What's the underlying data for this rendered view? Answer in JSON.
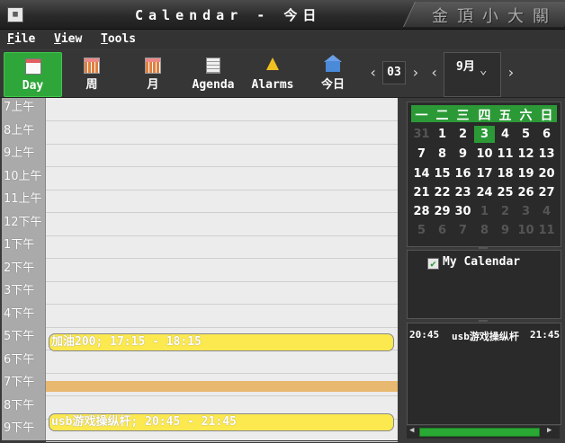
{
  "window": {
    "title": "Calendar - 今日",
    "brand": "金頂小大關"
  },
  "menu": [
    {
      "label": "File",
      "key": "F",
      "rest": "ile"
    },
    {
      "label": "View",
      "key": "V",
      "rest": "iew"
    },
    {
      "label": "Tools",
      "key": "T",
      "rest": "ools"
    }
  ],
  "toolbar": {
    "day": "Day",
    "week": "周",
    "month": "月",
    "agenda": "Agenda",
    "alarms": "Alarms",
    "today": "今日",
    "day_value": "03",
    "month_value": "9月"
  },
  "hours": [
    "7上午",
    "8上午",
    "9上午",
    "10上午",
    "11上午",
    "12下午",
    "1下午",
    "2下午",
    "3下午",
    "4下午",
    "5下午",
    "6下午",
    "7下午",
    "8下午",
    "9下午"
  ],
  "events": [
    {
      "text": "加油200; 17:15 - 18:15"
    },
    {
      "text": "usb游戏操纵杆; 20:45 - 21:45"
    }
  ],
  "mini_calendar": {
    "weekdays": [
      "一",
      "二",
      "三",
      "四",
      "五",
      "六",
      "日"
    ],
    "weeks": [
      [
        "31",
        "1",
        "2",
        "3",
        "4",
        "5",
        "6"
      ],
      [
        "7",
        "8",
        "9",
        "10",
        "11",
        "12",
        "13"
      ],
      [
        "14",
        "15",
        "16",
        "17",
        "18",
        "19",
        "20"
      ],
      [
        "21",
        "22",
        "23",
        "24",
        "25",
        "26",
        "27"
      ],
      [
        "28",
        "29",
        "30",
        "1",
        "2",
        "3",
        "4"
      ],
      [
        "5",
        "6",
        "7",
        "8",
        "9",
        "10",
        "11"
      ]
    ],
    "selected": "3"
  },
  "calendars": [
    {
      "name": "My Calendar",
      "checked": true
    }
  ],
  "agenda_list": {
    "start": "20:45",
    "title": "usb游戏操纵杆",
    "end": "21:45"
  },
  "colors": {
    "accent": "#2b9a36",
    "event": "#fce94f",
    "now_band": "#e8b870"
  }
}
